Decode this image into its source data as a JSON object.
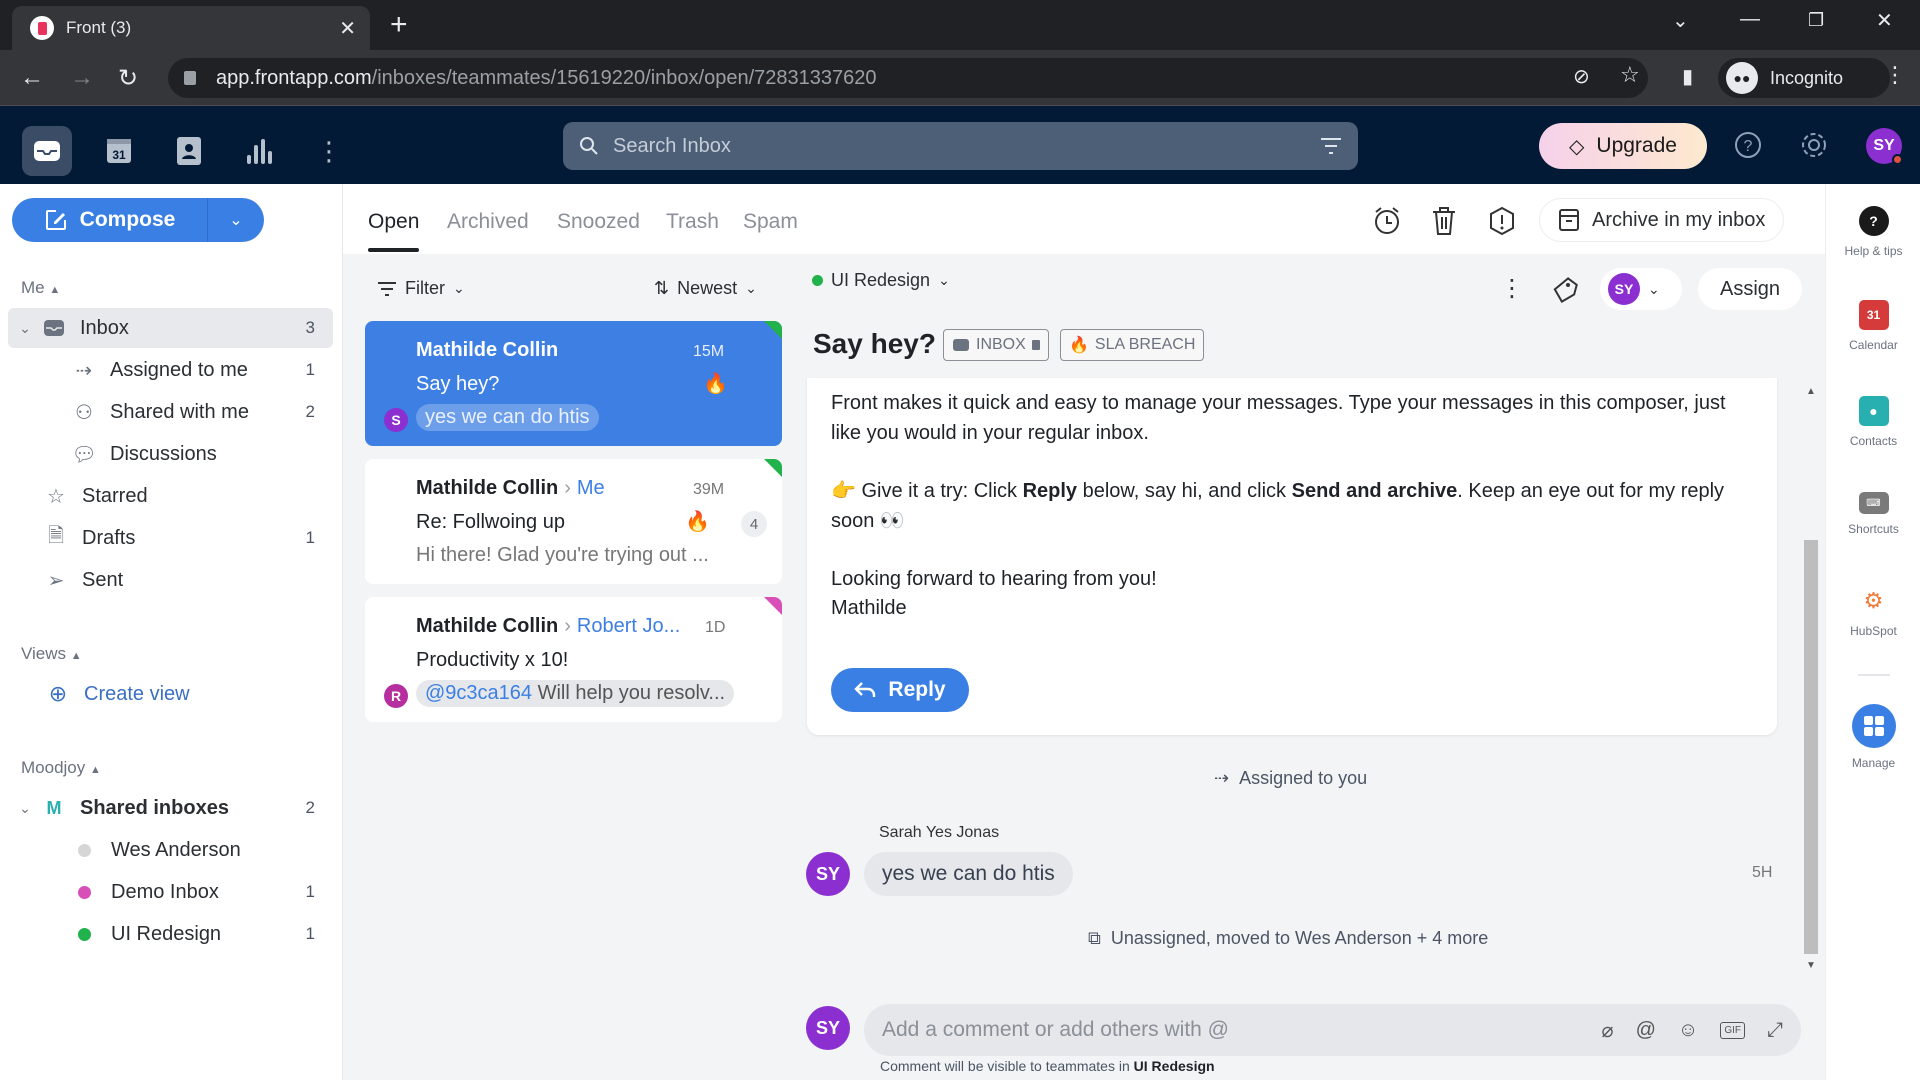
{
  "browser": {
    "tab_title": "Front (3)",
    "url_domain": "app.frontapp.com",
    "url_path": "/inboxes/teammates/15619220/inbox/open/72831337620",
    "profile_label": "Incognito"
  },
  "header": {
    "search_placeholder": "Search Inbox",
    "upgrade_label": "Upgrade",
    "user_initials": "SY",
    "nav_icons": [
      "inbox-icon",
      "calendar-icon",
      "contacts-icon",
      "analytics-icon",
      "more-icon"
    ]
  },
  "sidebar": {
    "compose_label": "Compose",
    "me_section": "Me",
    "items": [
      {
        "label": "Inbox",
        "count": "3",
        "icon": "inbox-icon"
      },
      {
        "label": "Assigned to me",
        "count": "1",
        "icon": "assigned-icon"
      },
      {
        "label": "Shared with me",
        "count": "2",
        "icon": "shared-icon"
      },
      {
        "label": "Discussions",
        "count": "",
        "icon": "discussion-icon"
      },
      {
        "label": "Starred",
        "count": "",
        "icon": "star-icon"
      },
      {
        "label": "Drafts",
        "count": "1",
        "icon": "draft-icon"
      },
      {
        "label": "Sent",
        "count": "",
        "icon": "sent-icon"
      }
    ],
    "views_section": "Views",
    "create_view_label": "Create view",
    "team_section": "Moodjoy",
    "team_badge": "M",
    "shared_inboxes": {
      "label": "Shared inboxes",
      "count": "2"
    },
    "inboxes": [
      {
        "label": "Wes Anderson",
        "count": "",
        "color": "#d6d6d6"
      },
      {
        "label": "Demo Inbox",
        "count": "1",
        "color": "#d94fb8"
      },
      {
        "label": "UI Redesign",
        "count": "1",
        "color": "#21b24b"
      }
    ]
  },
  "tabs": [
    {
      "label": "Open",
      "active": true
    },
    {
      "label": "Archived"
    },
    {
      "label": "Snoozed"
    },
    {
      "label": "Trash"
    },
    {
      "label": "Spam"
    }
  ],
  "list": {
    "filter_label": "Filter",
    "sort_label": "Newest",
    "conversations": [
      {
        "sender": "Mathilde Collin",
        "to": "",
        "time": "15M",
        "subject": "Say hey?",
        "preview": "yes we can do htis",
        "preview_mention": "",
        "avatar": "S",
        "avatar_color": "#8b2fd1",
        "corner_color": "#21b24b",
        "fire": "🔥",
        "count": ""
      },
      {
        "sender": "Mathilde Collin",
        "to": "Me",
        "time": "39M",
        "subject": "Re: Follwoing up",
        "preview": "Hi there! Glad you're trying out ...",
        "preview_mention": "",
        "avatar": "",
        "avatar_color": "",
        "corner_color": "#21b24b",
        "fire": "🔥",
        "count": "4"
      },
      {
        "sender": "Mathilde Collin",
        "to": "Robert Jo...",
        "time": "1D",
        "subject": "Productivity x 10!",
        "preview": "Will help you resolv...",
        "preview_mention": "@9c3ca164",
        "avatar": "R",
        "avatar_color": "#b52f9e",
        "corner_color": "#d94fb8",
        "fire": "",
        "count": ""
      }
    ]
  },
  "conversation": {
    "toolbar": {
      "archive_label": "Archive in my inbox"
    },
    "inbox_label": "UI Redesign",
    "assignee_initials": "SY",
    "assign_label": "Assign",
    "subject": "Say hey?",
    "tags": [
      {
        "label": "INBOX",
        "icon": "inbox-icon"
      },
      {
        "label": "SLA BREACH",
        "icon": "fire-icon"
      }
    ],
    "message": {
      "para1": "Front makes it quick and easy to manage your messages. Type your messages in this composer, just like you would in your regular inbox.",
      "para2_a": "👉 Give it a try: Click ",
      "para2_b": "Reply",
      "para2_c": " below, say hi, and click ",
      "para2_d": "Send and archive",
      "para2_e": ". Keep an eye out for my reply soon 👀",
      "para3": "Looking forward to hearing from you!",
      "signature": "Mathilde",
      "reply_label": "Reply"
    },
    "events": {
      "assigned": "Assigned to you",
      "moved": "Unassigned, moved to Wes Anderson + 4 more"
    },
    "comment": {
      "author": "Sarah Yes Jonas",
      "initials": "SY",
      "text": "yes we can do htis",
      "time": "5H"
    },
    "composer": {
      "placeholder": "Add a comment or add others with @",
      "note_prefix": "Comment will be visible to teammates in ",
      "note_inbox": "UI Redesign"
    }
  },
  "rail": [
    {
      "label": "Help & tips",
      "icon": "help-icon",
      "color": "#1a1a1a"
    },
    {
      "label": "Calendar",
      "icon": "calendar-icon",
      "color": "#d63b3b"
    },
    {
      "label": "Contacts",
      "icon": "contacts-icon",
      "color": "#28b0b0"
    },
    {
      "label": "Shortcuts",
      "icon": "keyboard-icon",
      "color": "#7a7a7a"
    },
    {
      "label": "HubSpot",
      "icon": "hubspot-icon",
      "color": "#f07a3a"
    },
    {
      "label": "Manage",
      "icon": "grid-icon",
      "color": "#3a7fe3"
    }
  ]
}
